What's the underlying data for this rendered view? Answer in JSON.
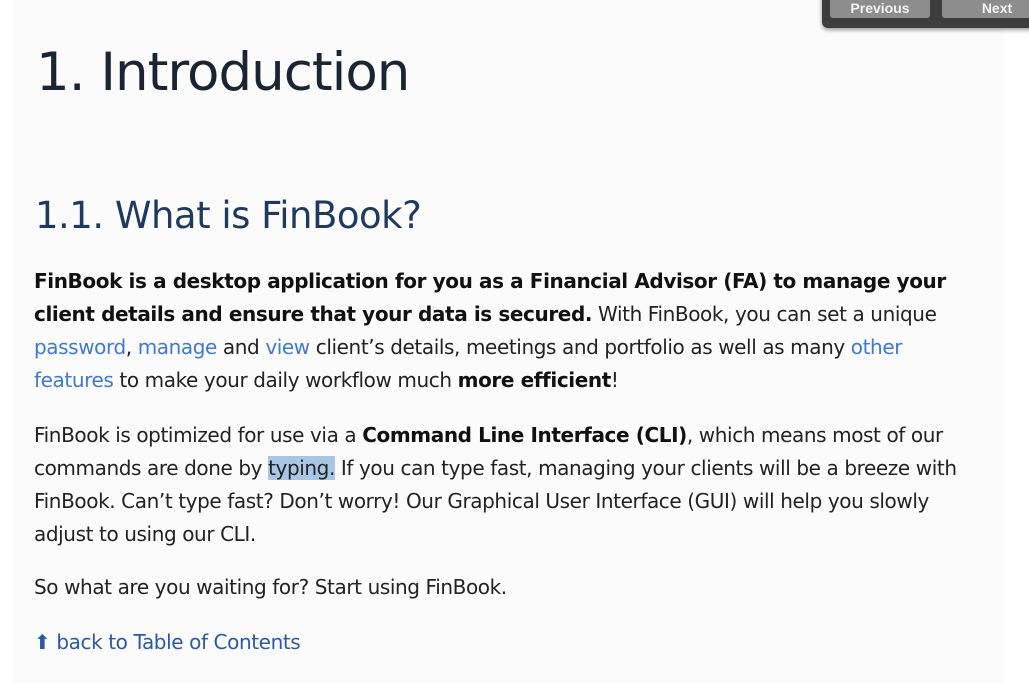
{
  "nav": {
    "previous_label": "Previous",
    "next_label": "Next"
  },
  "heading": "1. Introduction",
  "subheading": "1.1. What is FinBook?",
  "intro": {
    "bold_lead": "FinBook is a desktop application for you as a Financial Advisor (FA) to manage your client details and ensure that your data is secured.",
    "text_1": " With FinBook, you can set a unique ",
    "link_password": "password",
    "text_2": ", ",
    "link_manage": "manage",
    "text_3": " and ",
    "link_view": "view",
    "text_4": " client’s details, meetings and portfolio as well as many ",
    "link_other": "other features",
    "text_5": " to make your daily workflow much ",
    "bold_efficient": "more efficient",
    "text_6": "!"
  },
  "cli": {
    "text_1": "FinBook is optimized for use via a ",
    "bold_cli": "Command Line Interface (CLI)",
    "text_2": ", which means most of our commands are done by ",
    "highlight": "typing.",
    "text_3": " If you can type fast, managing your clients will be a breeze with FinBook. Can’t type fast? Don’t worry! Our Graphical User Interface (GUI) will help you slowly adjust to using our CLI."
  },
  "closing": "So what are you waiting for? Start using FinBook.",
  "back_link": "⬆ back to Table of Contents",
  "colors": {
    "link": "#3f7ad1",
    "heading": "#1f3a5f",
    "selection": "#a8c7e4"
  }
}
